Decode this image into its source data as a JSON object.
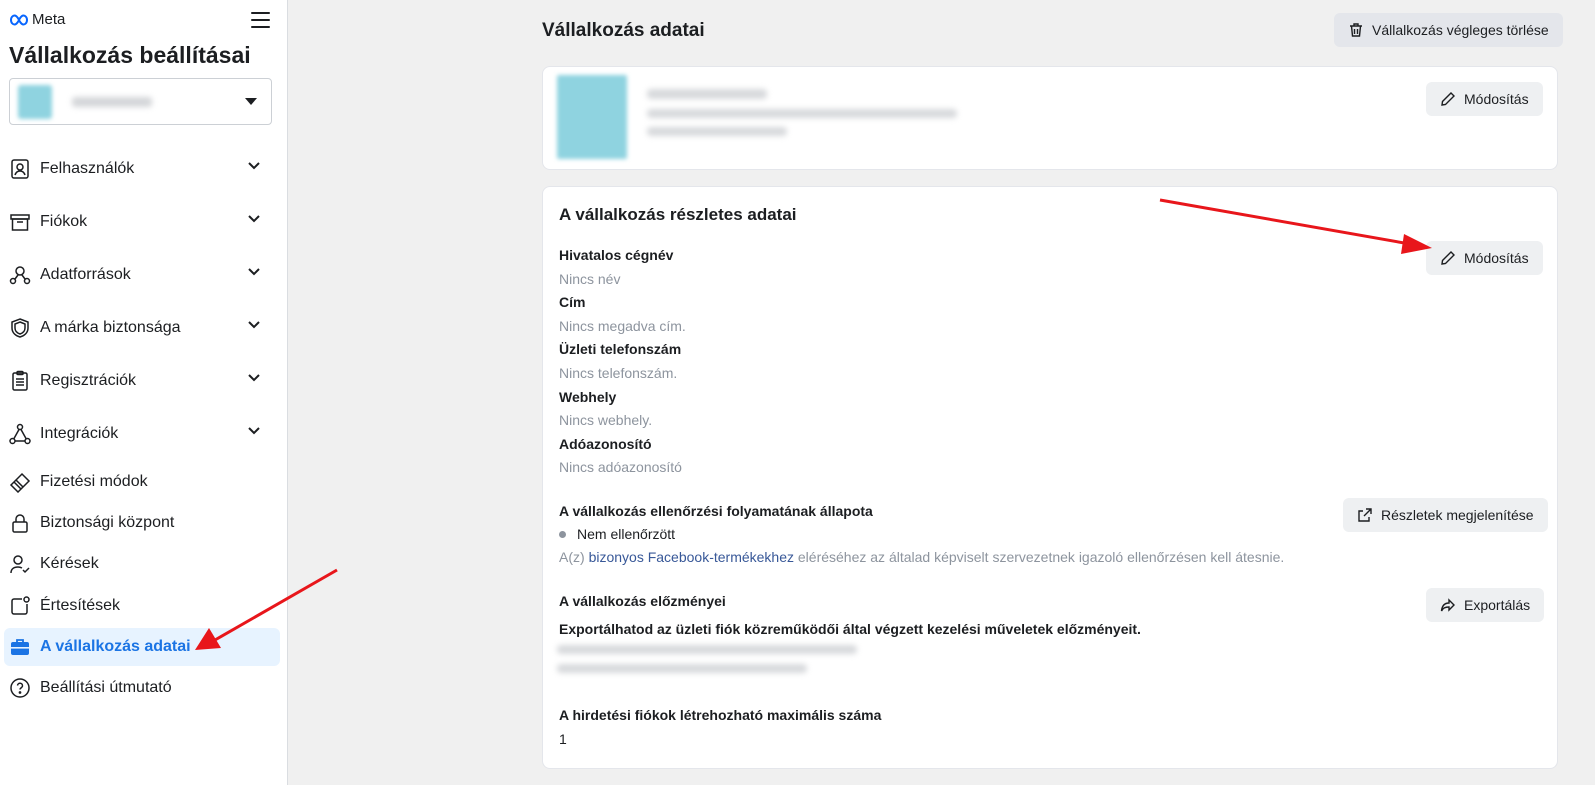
{
  "brand": {
    "logo_text": "Meta"
  },
  "sidebar": {
    "title": "Vállalkozás beállításai",
    "items": [
      {
        "label": "Felhasználók",
        "icon": "users-icon",
        "has_chevron": true
      },
      {
        "label": "Fiókok",
        "icon": "archive-box-icon",
        "has_chevron": true
      },
      {
        "label": "Adatforrások",
        "icon": "data-sources-icon",
        "has_chevron": true
      },
      {
        "label": "A márka biztonsága",
        "icon": "shield-icon",
        "has_chevron": true
      },
      {
        "label": "Regisztrációk",
        "icon": "clipboard-icon",
        "has_chevron": true
      },
      {
        "label": "Integrációk",
        "icon": "integrations-icon",
        "has_chevron": true
      },
      {
        "label": "Fizetési módok",
        "icon": "credit-card-icon",
        "has_chevron": false
      },
      {
        "label": "Biztonsági központ",
        "icon": "lock-icon",
        "has_chevron": false
      },
      {
        "label": "Kérések",
        "icon": "person-check-icon",
        "has_chevron": false
      },
      {
        "label": "Értesítések",
        "icon": "notification-icon",
        "has_chevron": false
      },
      {
        "label": "A vállalkozás adatai",
        "icon": "briefcase-icon",
        "has_chevron": false,
        "active": true
      },
      {
        "label": "Beállítási útmutató",
        "icon": "help-circle-icon",
        "has_chevron": false
      }
    ]
  },
  "main": {
    "title": "Vállalkozás adatai",
    "delete_button": "Vállalkozás végleges törlése",
    "edit_label": "Módosítás",
    "details": {
      "title": "A vállalkozás részletes adatai",
      "fields": [
        {
          "label": "Hivatalos cégnév",
          "value": "Nincs név"
        },
        {
          "label": "Cím",
          "value": "Nincs megadva cím."
        },
        {
          "label": "Üzleti telefonszám",
          "value": "Nincs telefonszám."
        },
        {
          "label": "Webhely",
          "value": "Nincs webhely."
        },
        {
          "label": "Adóazonosító",
          "value": "Nincs adóazonosító"
        }
      ],
      "verification": {
        "label": "A vállalkozás ellenőrzési folyamatának állapota",
        "status": "Nem ellenőrzött",
        "note_prefix": "A(z) ",
        "note_link": "bizonyos Facebook-termékekhez",
        "note_suffix": " eléréséhez az általad képviselt szervezetnek igazoló ellenőrzésen kell átesnie.",
        "button": "Részletek megjelenítése"
      },
      "history": {
        "label": "A vállalkozás előzményei",
        "desc": "Exportálhatod az üzleti fiók közreműködői által végzett kezelési műveletek előzményeit.",
        "button": "Exportálás"
      },
      "max_ad_accounts": {
        "label": "A hirdetési fiókok létrehozható maximális száma",
        "value": "1"
      }
    }
  },
  "colors": {
    "accent": "#1b74e4",
    "arrow": "#e8161b"
  }
}
